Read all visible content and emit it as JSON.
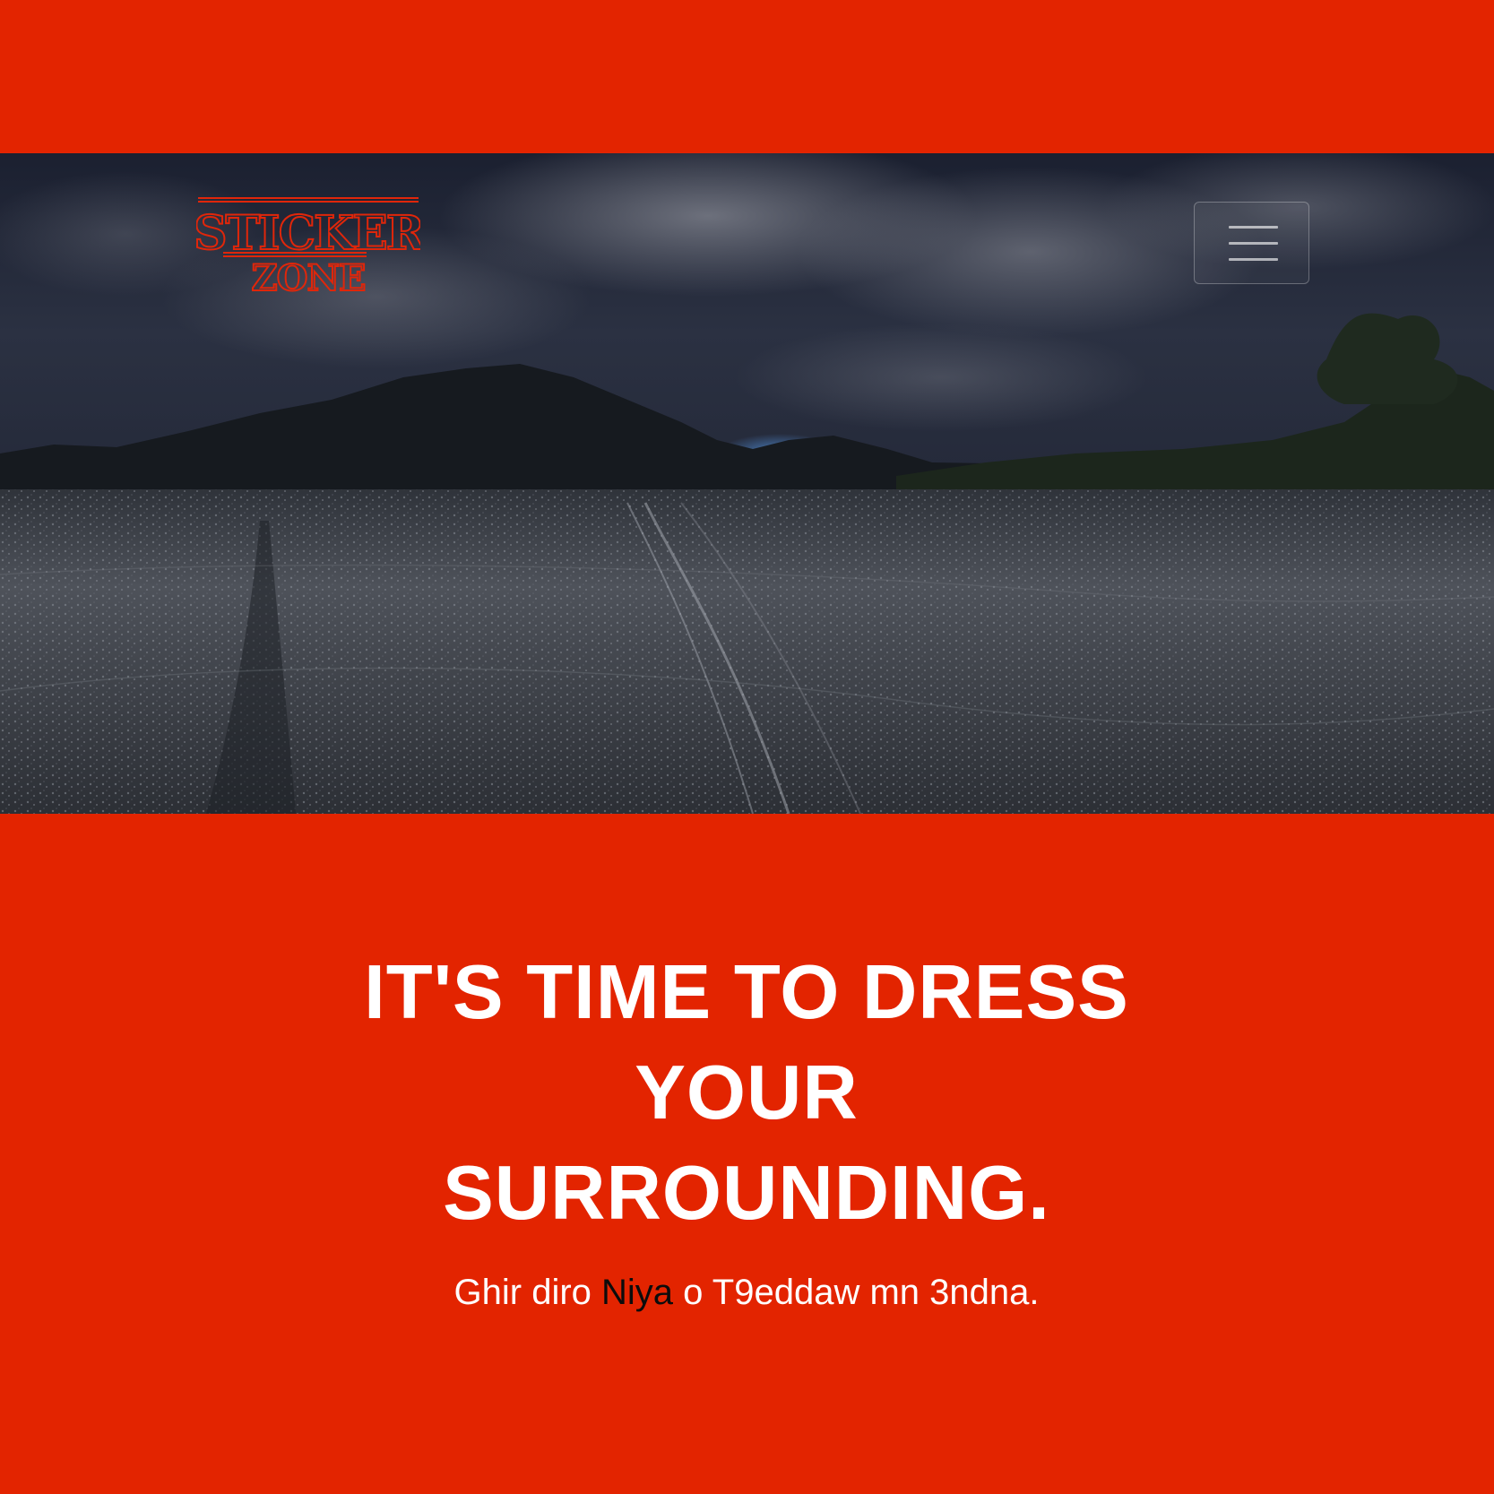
{
  "brand": {
    "logo_line1": "STICKER",
    "logo_line2": "ZONE"
  },
  "navbar": {
    "toggle_icon": "hamburger-menu-icon"
  },
  "hero": {
    "headline_line1": "IT'S TIME TO DRESS",
    "headline_line2": "YOUR",
    "headline_line3": "SURROUNDING.",
    "tagline_before": "Ghir diro ",
    "tagline_highlight": "Niya",
    "tagline_after": " o T9eddaw mn 3ndna."
  },
  "colors": {
    "background": "#e32400",
    "text": "#ffffff",
    "tagline_highlight": "#0c0c0c",
    "logo": "#e0260a"
  }
}
